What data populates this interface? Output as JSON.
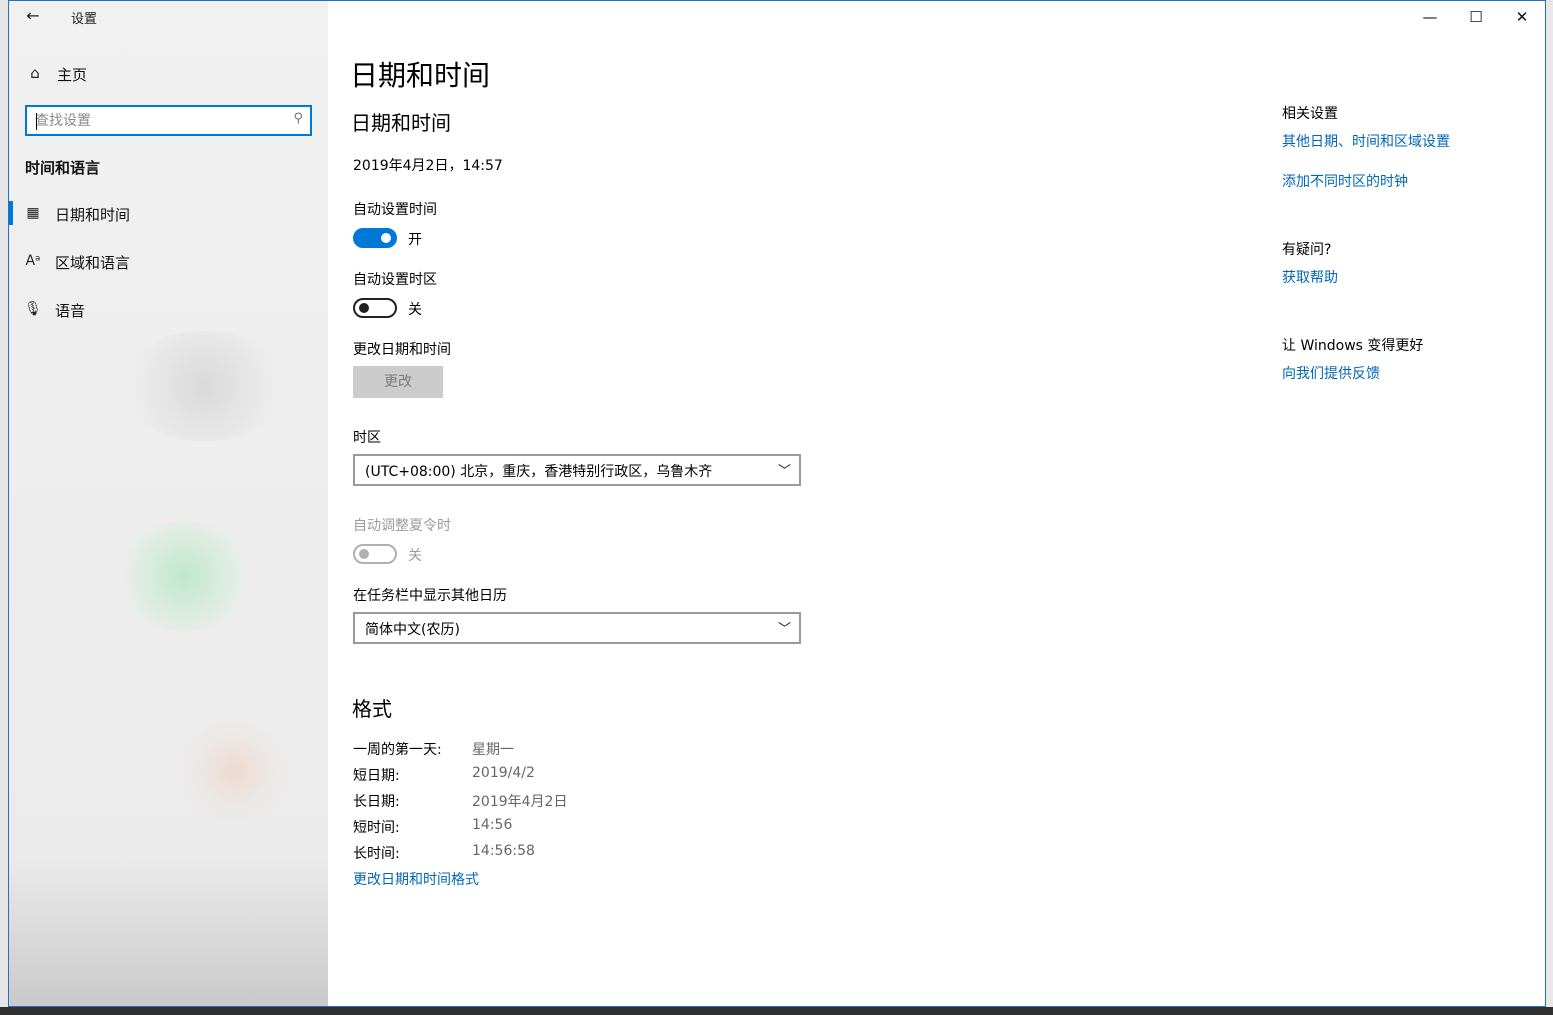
{
  "window": {
    "app_title": "设置",
    "back_icon": "back-arrow-icon"
  },
  "caption_buttons": {
    "minimize": "—",
    "maximize": "☐",
    "close": "✕"
  },
  "sidebar": {
    "home_label": "主页",
    "search_placeholder": "查找设置",
    "section_title": "时间和语言",
    "items": [
      {
        "label": "日期和时间",
        "icon": "calendar-clock-icon",
        "selected": true
      },
      {
        "label": "区域和语言",
        "icon": "language-icon",
        "selected": false
      },
      {
        "label": "语音",
        "icon": "microphone-icon",
        "selected": false
      }
    ]
  },
  "main": {
    "page_title": "日期和时间",
    "sub_title": "日期和时间",
    "current_datetime": "2019年4月2日，14:57",
    "auto_time": {
      "label": "自动设置时间",
      "state_text": "开",
      "on": true
    },
    "auto_timezone": {
      "label": "自动设置时区",
      "state_text": "关",
      "on": false
    },
    "change_datetime": {
      "label": "更改日期和时间",
      "button": "更改",
      "enabled": false
    },
    "timezone": {
      "label": "时区",
      "value": "(UTC+08:00) 北京，重庆，香港特别行政区，乌鲁木齐"
    },
    "dst": {
      "label": "自动调整夏令时",
      "state_text": "关",
      "on": false,
      "enabled": false
    },
    "calendar": {
      "label": "在任务栏中显示其他日历",
      "value": "简体中文(农历)"
    },
    "format": {
      "title": "格式",
      "rows": [
        {
          "key": "一周的第一天:",
          "value": "星期一"
        },
        {
          "key": "短日期:",
          "value": "2019/4/2"
        },
        {
          "key": "长日期:",
          "value": "2019年4月2日"
        },
        {
          "key": "短时间:",
          "value": "14:56"
        },
        {
          "key": "长时间:",
          "value": "14:56:58"
        }
      ],
      "change_link": "更改日期和时间格式"
    }
  },
  "related": {
    "heading": "相关设置",
    "links": [
      "其他日期、时间和区域设置",
      "添加不同时区的时钟"
    ],
    "help_heading": "有疑问?",
    "help_link": "获取帮助",
    "feedback_heading": "让 Windows 变得更好",
    "feedback_link": "向我们提供反馈"
  },
  "colors": {
    "accent": "#0078d7",
    "link": "#0067b8",
    "disabled_text": "#9b9b9b"
  }
}
